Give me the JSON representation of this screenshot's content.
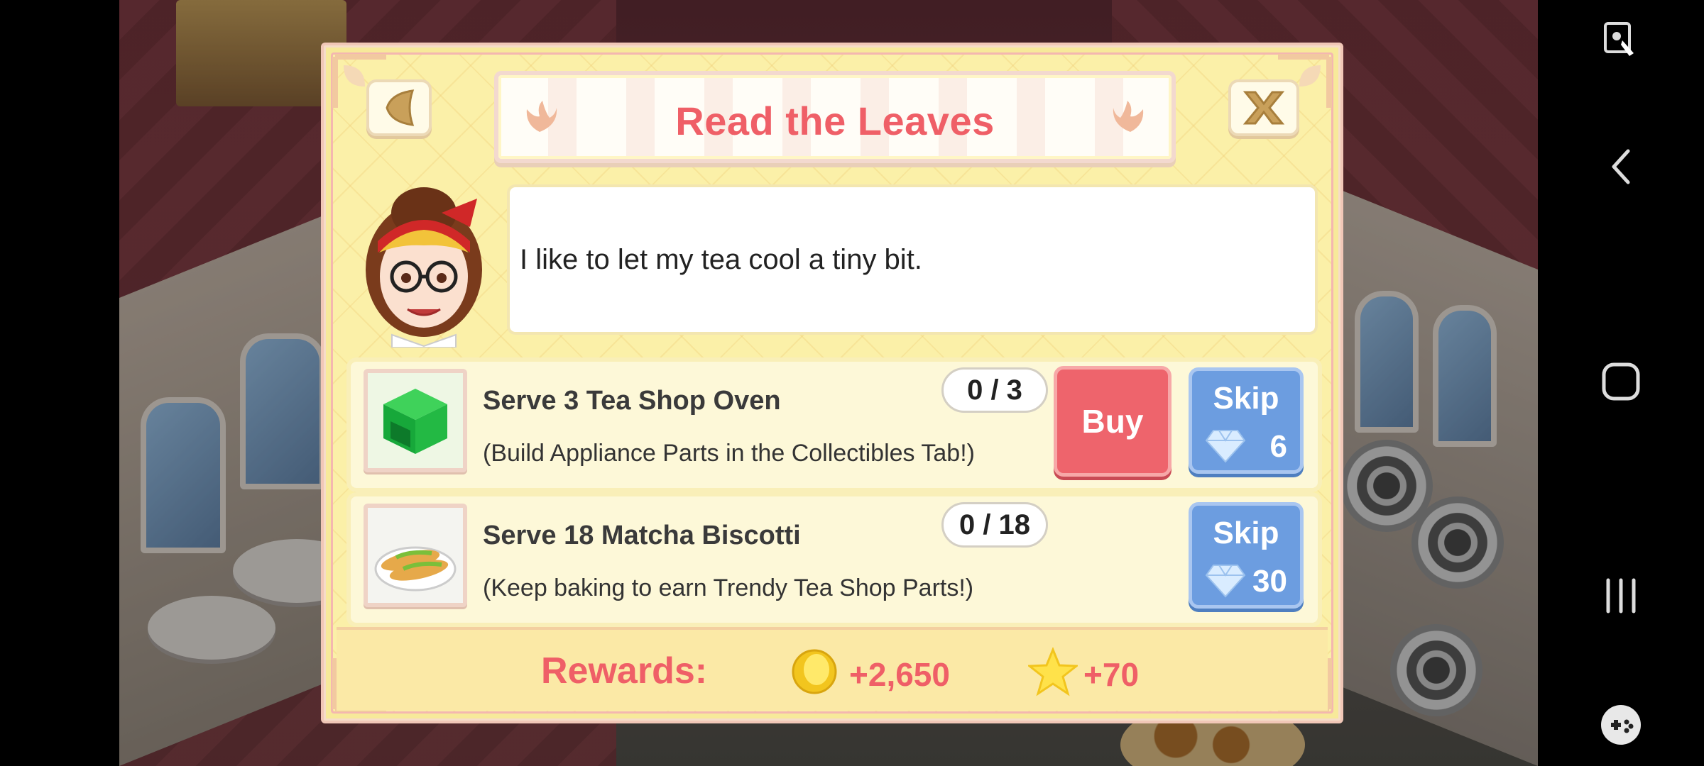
{
  "dialog": {
    "title": "Read the Leaves",
    "speech": "I like to let my tea cool a tiny bit.",
    "back_icon": "back-arrow-icon",
    "close_icon": "close-x-icon"
  },
  "tasks": [
    {
      "name": "Serve 3 Tea Shop Oven",
      "hint": "(Build Appliance Parts in the Collectibles Tab!)",
      "progress": "0 / 3",
      "buy_label": "Buy",
      "skip_label": "Skip",
      "skip_cost": "6",
      "thumb_icon": "green-oven-icon"
    },
    {
      "name": "Serve 18 Matcha Biscotti",
      "hint": "(Keep baking to earn Trendy Tea Shop Parts!)",
      "progress": "0 / 18",
      "skip_label": "Skip",
      "skip_cost": "30",
      "thumb_icon": "biscotti-plate-icon"
    }
  ],
  "rewards": {
    "label": "Rewards:",
    "coins": "+2,650",
    "stars": "+70"
  },
  "colors": {
    "title": "#ef5f67",
    "buy": "#ee646c",
    "skip": "#6c9de0",
    "panel": "#f7e99a"
  },
  "nav": {
    "icons": [
      "screen-pin-icon",
      "back-nav-icon",
      "home-nav-icon",
      "recents-nav-icon",
      "game-tools-icon"
    ]
  }
}
